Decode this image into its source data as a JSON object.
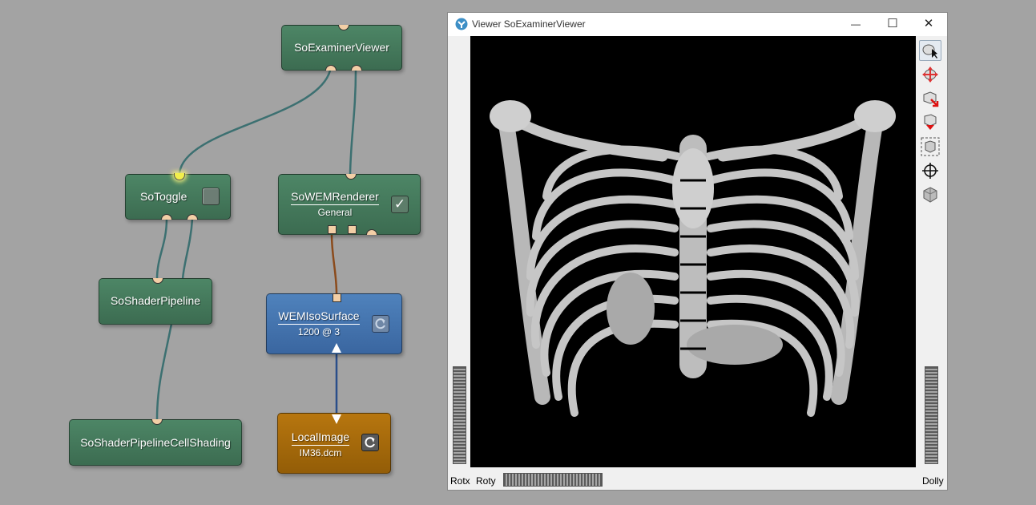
{
  "network": {
    "modules": {
      "so_examiner_viewer": {
        "title": "SoExaminerViewer"
      },
      "so_toggle": {
        "title": "SoToggle"
      },
      "so_wem_renderer": {
        "title": "SoWEMRenderer",
        "subtitle": "General",
        "checked": true
      },
      "so_shader_pipeline": {
        "title": "SoShaderPipeline"
      },
      "wem_iso_surface": {
        "title": "WEMIsoSurface",
        "subtitle": "1200 @ 3"
      },
      "so_shader_pipeline_cell_shading": {
        "title": "SoShaderPipelineCellShading"
      },
      "local_image": {
        "title": "LocalImage",
        "subtitle": "IM36.dcm"
      }
    }
  },
  "viewer_window": {
    "title": "Viewer SoExaminerViewer",
    "controls": {
      "minimize": "—",
      "maximize": "☐",
      "close": "✕"
    },
    "toolbar_icons": [
      "pick-mode-icon",
      "view-mode-icon",
      "home-icon",
      "set-home-icon",
      "view-all-icon",
      "seek-icon",
      "perspective-camera-icon"
    ],
    "labels": {
      "rotx": "Rotx",
      "roty": "Roty",
      "dolly": "Dolly"
    }
  },
  "colors": {
    "module_green": "#417558",
    "module_blue": "#4474ae",
    "module_orange": "#a66a0c",
    "connection_teal": "#3c7071",
    "connection_brown": "#8b4b1c",
    "connection_blue": "#2a4e8a",
    "port": "#f3cfa6",
    "viewport_bg": "#000000"
  }
}
